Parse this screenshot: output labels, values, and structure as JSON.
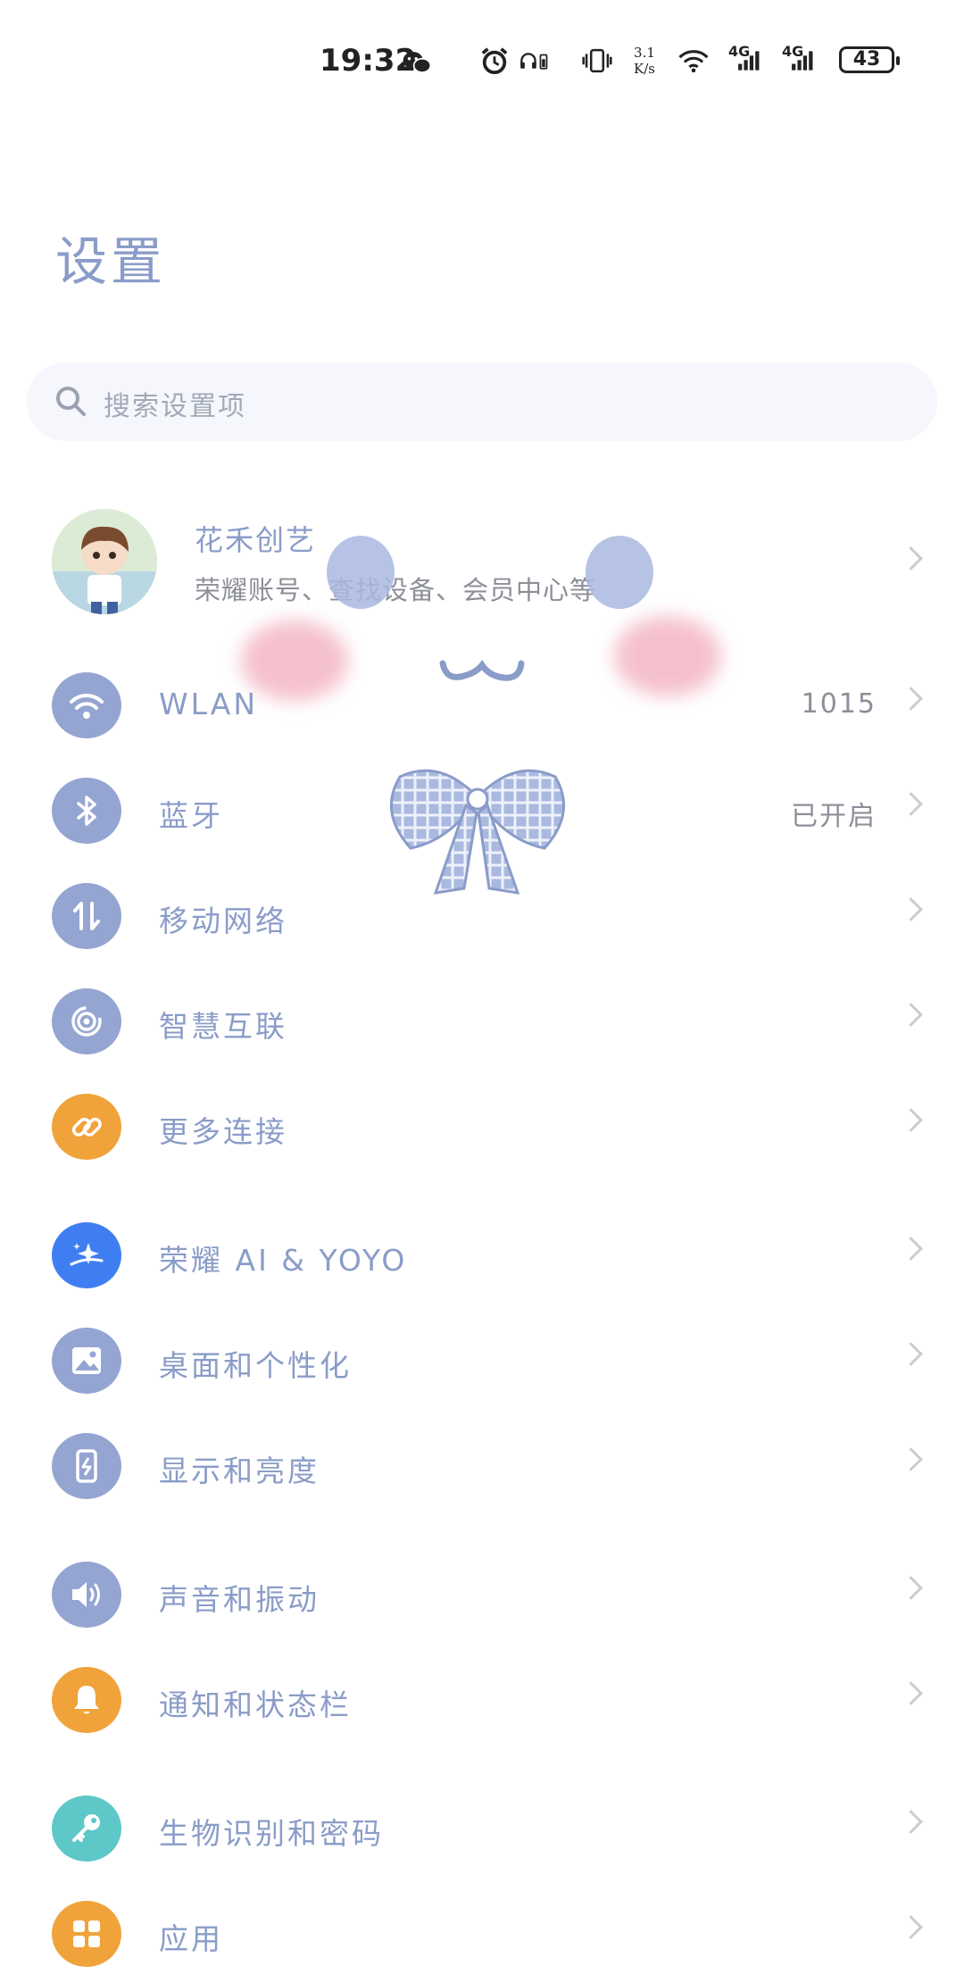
{
  "status_bar": {
    "time": "19:32",
    "speed_value": "3.1",
    "speed_unit": "K/s",
    "network_1": "4G",
    "network_2": "4G",
    "battery": "43"
  },
  "page": {
    "title": "设置"
  },
  "search": {
    "placeholder": "搜索设置项"
  },
  "profile": {
    "name": "花禾创艺",
    "subtitle": "荣耀账号、查找设备、会员中心等"
  },
  "settings": [
    {
      "label": "WLAN",
      "value": "1015",
      "icon": "wifi-icon",
      "color": "#95a5d2"
    },
    {
      "label": "蓝牙",
      "value": "已开启",
      "icon": "bluetooth-icon",
      "color": "#95a5d2"
    },
    {
      "label": "移动网络",
      "value": "",
      "icon": "mobile-data-icon",
      "color": "#95a5d2"
    },
    {
      "label": "智慧互联",
      "value": "",
      "icon": "smart-connect-icon",
      "color": "#95a5d2"
    },
    {
      "label": "更多连接",
      "value": "",
      "icon": "link-icon",
      "color": "#f0a33a"
    },
    {
      "label": "荣耀 AI & YOYO",
      "value": "",
      "icon": "ai-sparkle-icon",
      "color": "#3f7ef2"
    },
    {
      "label": "桌面和个性化",
      "value": "",
      "icon": "image-icon",
      "color": "#95a5d2"
    },
    {
      "label": "显示和亮度",
      "value": "",
      "icon": "display-icon",
      "color": "#95a5d2"
    },
    {
      "label": "声音和振动",
      "value": "",
      "icon": "speaker-icon",
      "color": "#95a5d2"
    },
    {
      "label": "通知和状态栏",
      "value": "",
      "icon": "bell-icon",
      "color": "#f0a33a"
    },
    {
      "label": "生物识别和密码",
      "value": "",
      "icon": "key-icon",
      "color": "#5ec7c7"
    },
    {
      "label": "应用",
      "value": "",
      "icon": "apps-icon",
      "color": "#f0a33a"
    }
  ]
}
